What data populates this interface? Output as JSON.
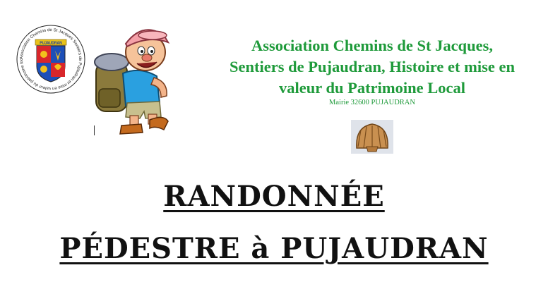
{
  "logo": {
    "ring_text": "Association Chemins de St Jacques Sentiers de Pujaudran et mise en valeur du patrimoine local.",
    "banner_text": "PUJAUDRAN"
  },
  "association": {
    "lines": [
      "Association Chemins de St Jacques,",
      "Sentiers de Pujaudran, Histoire et mise en",
      "valeur du Patrimoine Local"
    ],
    "address": "Mairie  32600 PUJAUDRAN"
  },
  "title": {
    "line1": "RANDONNÉE",
    "line2": "PÉDESTRE à PUJAUDRAN"
  },
  "colors": {
    "association_text": "#1e9a3a",
    "title_text": "#111111"
  },
  "icons": [
    "seal-logo-icon",
    "hiker-mascot-icon",
    "scallop-shell-icon"
  ]
}
